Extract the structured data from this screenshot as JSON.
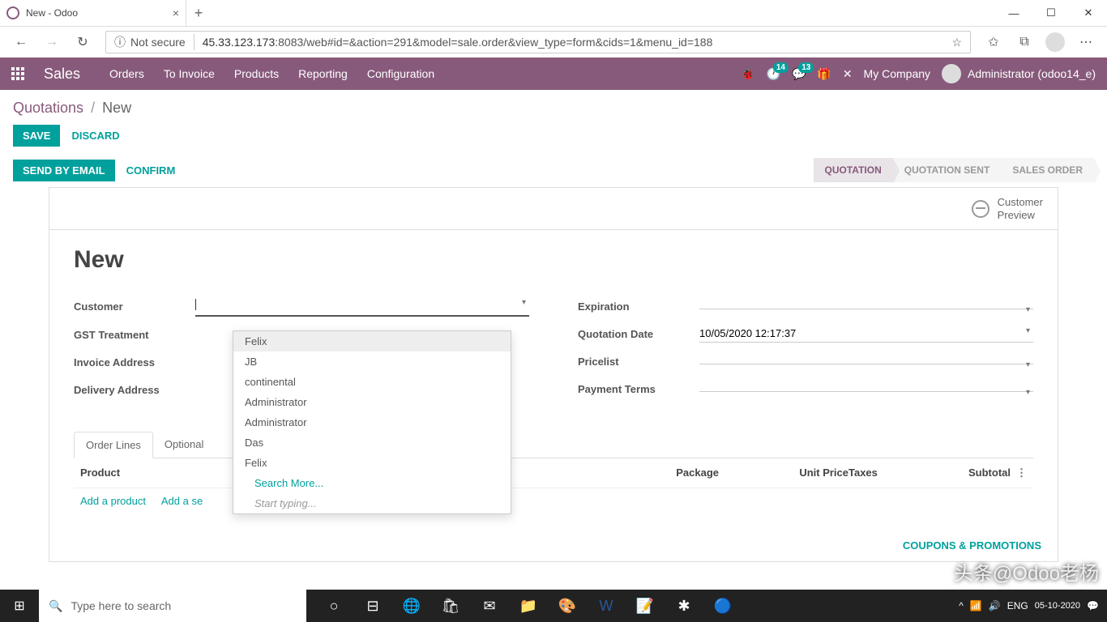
{
  "browser": {
    "tab_title": "New - Odoo",
    "not_secure": "Not secure",
    "url_host": "45.33.123.173",
    "url_path": ":8083/web#id=&action=291&model=sale.order&view_type=form&cids=1&menu_id=188"
  },
  "odoo": {
    "app": "Sales",
    "menus": [
      "Orders",
      "To Invoice",
      "Products",
      "Reporting",
      "Configuration"
    ],
    "badge1": "14",
    "badge2": "13",
    "company": "My Company",
    "user": "Administrator (odoo14_e)"
  },
  "breadcrumb": {
    "root": "Quotations",
    "current": "New"
  },
  "buttons": {
    "save": "SAVE",
    "discard": "DISCARD",
    "send": "SEND BY EMAIL",
    "confirm": "CONFIRM"
  },
  "status": [
    "QUOTATION",
    "QUOTATION SENT",
    "SALES ORDER"
  ],
  "preview": {
    "line1": "Customer",
    "line2": "Preview"
  },
  "form": {
    "title": "New",
    "left_labels": [
      "Customer",
      "GST Treatment",
      "Invoice Address",
      "Delivery Address"
    ],
    "right": {
      "expiration": {
        "label": "Expiration",
        "value": ""
      },
      "quotation_date": {
        "label": "Quotation Date",
        "value": "10/05/2020 12:17:37"
      },
      "pricelist": {
        "label": "Pricelist",
        "value": ""
      },
      "payment_terms": {
        "label": "Payment Terms",
        "value": ""
      }
    }
  },
  "dropdown": {
    "items": [
      "Felix",
      "JB",
      "continental",
      "Administrator",
      "Administrator",
      "Das",
      "Felix"
    ],
    "search_more": "Search More...",
    "hint": "Start typing..."
  },
  "tabs": [
    "Order Lines",
    "Optional"
  ],
  "table": {
    "headers": {
      "product": "Product",
      "package": "Package",
      "unit_price": "Unit Price",
      "taxes": "Taxes",
      "subtotal": "Subtotal"
    },
    "add_product": "Add a product",
    "add_section": "Add a se"
  },
  "footer_link": "COUPONS & PROMOTIONS",
  "watermark": "头条@Odoo老杨",
  "taskbar": {
    "search": "Type here to search",
    "lang": "ENG",
    "time": "05-10-2020"
  }
}
